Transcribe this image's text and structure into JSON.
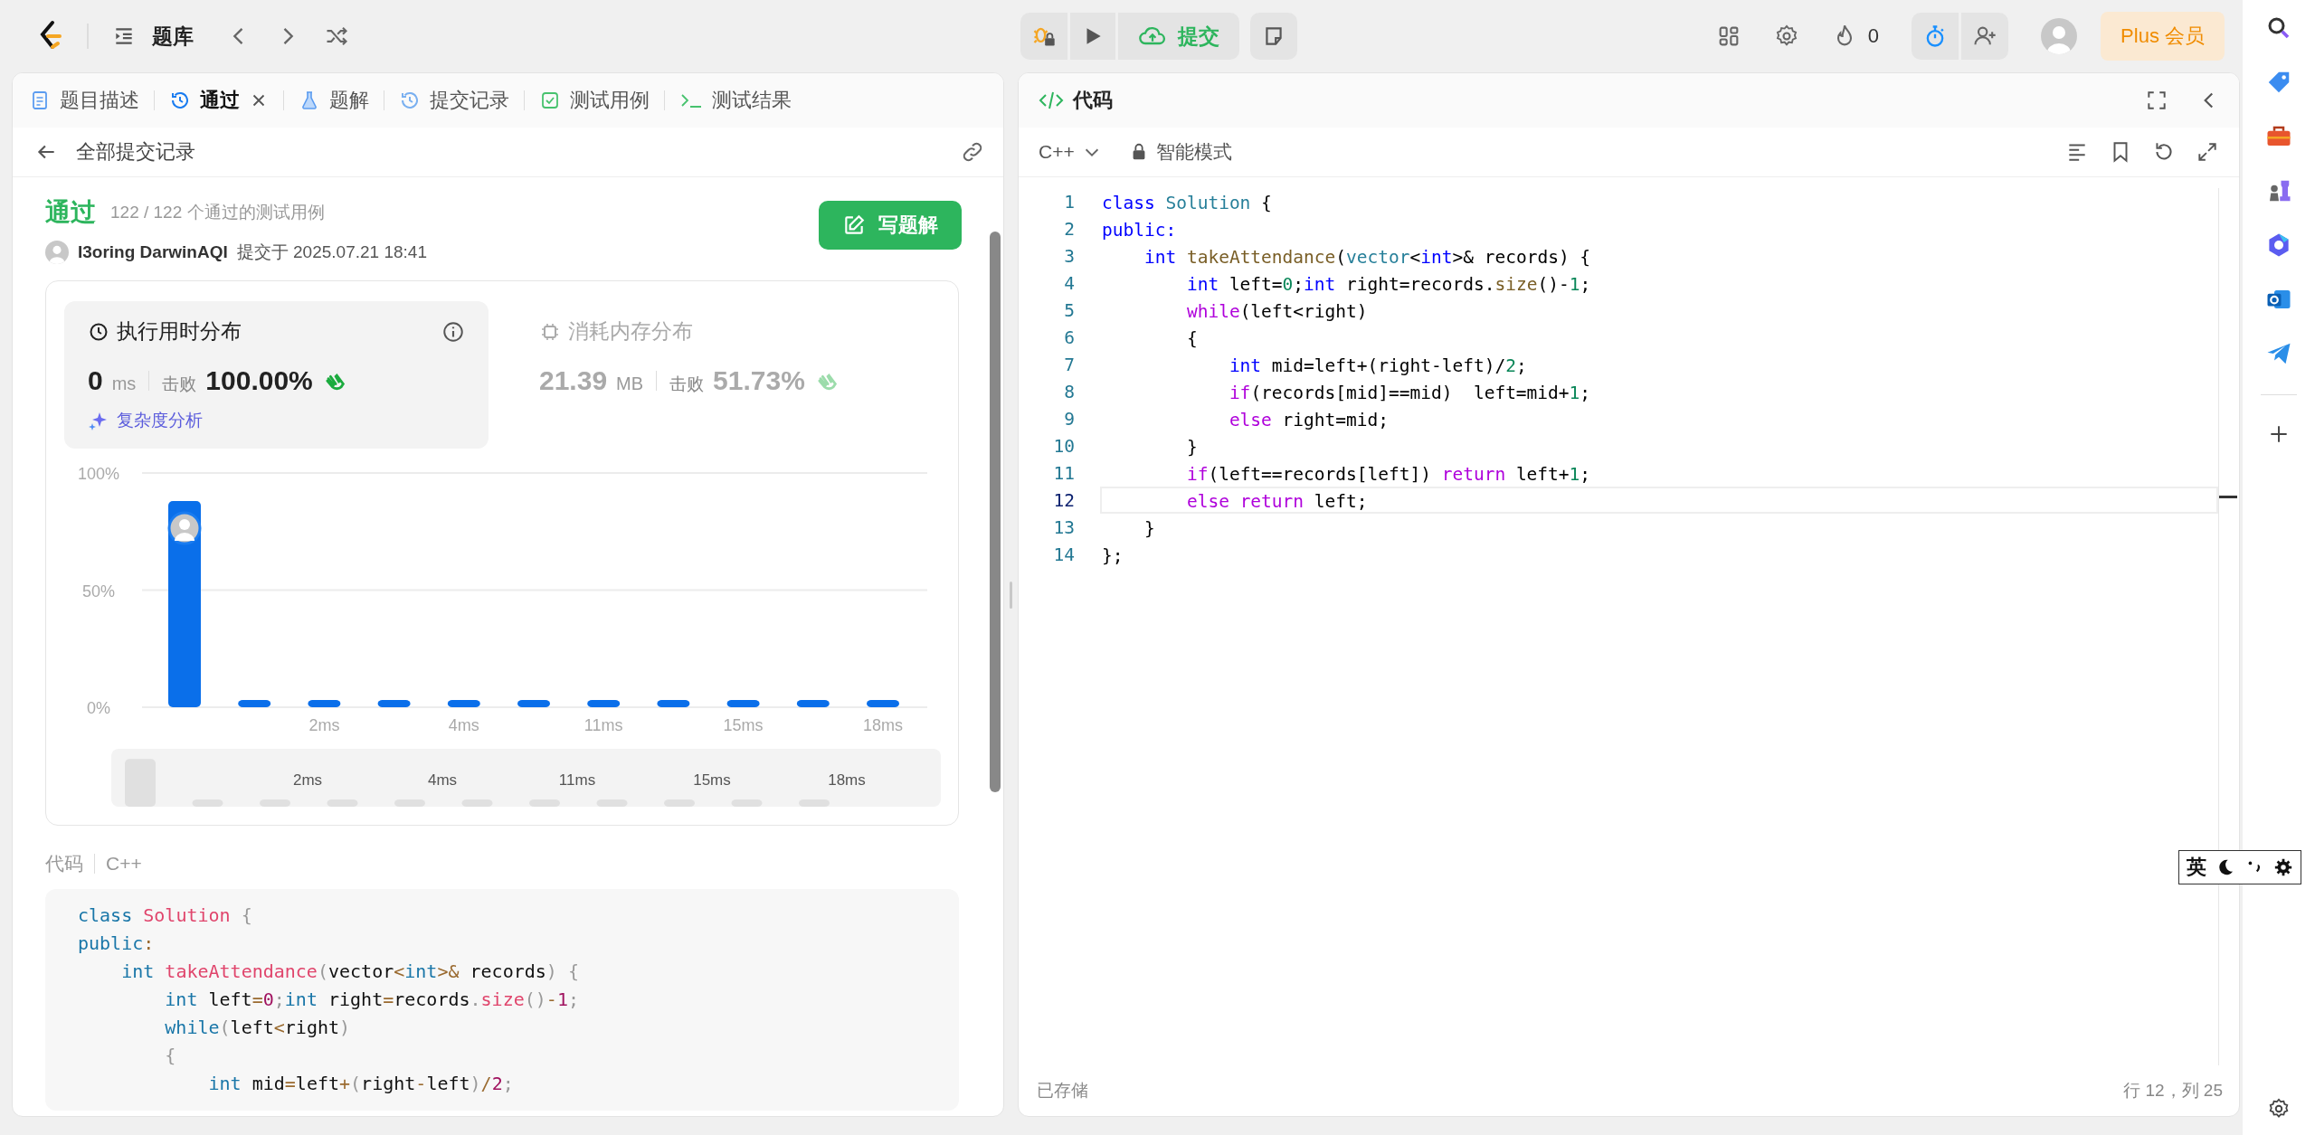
{
  "top_bar": {
    "nav_label": "题库",
    "submit_label": "提交",
    "streak": "0",
    "plus_label": "Plus 会员"
  },
  "left_tabs": [
    {
      "label": "题目描述",
      "kind": "doc",
      "selected": false,
      "closable": false
    },
    {
      "label": "通过",
      "kind": "history",
      "selected": true,
      "closable": true
    },
    {
      "label": "题解",
      "kind": "flask",
      "selected": false,
      "closable": false
    },
    {
      "label": "提交记录",
      "kind": "history",
      "selected": false,
      "closable": false
    },
    {
      "label": "测试用例",
      "kind": "check",
      "selected": false,
      "closable": false
    },
    {
      "label": "测试结果",
      "kind": "terminal",
      "selected": false,
      "closable": false
    }
  ],
  "back_label": "全部提交记录",
  "submission": {
    "status": "通过",
    "cases": "122 / 122 个通过的测试用例",
    "user": "I3oring DarwinAQI",
    "submitted": "提交于 2025.07.21 18:41",
    "write_button": "写题解"
  },
  "stats": [
    {
      "kind": "time",
      "title": "执行用时分布",
      "value": "0",
      "unit": "ms",
      "beats_label": "击败",
      "beats": "100.00%",
      "selected": true
    },
    {
      "kind": "memory",
      "title": "消耗内存分布",
      "value": "21.39",
      "unit": "MB",
      "beats_label": "击败",
      "beats": "51.73%",
      "selected": false
    }
  ],
  "complexity_link": "复杂度分析",
  "chart_data": {
    "type": "bar",
    "categories": [
      null,
      null,
      "2ms",
      null,
      "4ms",
      null,
      "11ms",
      null,
      "15ms",
      null,
      "18ms"
    ],
    "values": [
      88,
      3,
      3,
      3,
      3,
      3,
      3,
      3,
      3,
      3,
      3
    ],
    "ylim": [
      0,
      100
    ],
    "yticks": [
      {
        "value": 0,
        "label": "0%"
      },
      {
        "value": 50,
        "label": "50%"
      },
      {
        "value": 100,
        "label": "100%"
      }
    ]
  },
  "overview": {
    "labels": [
      "2ms",
      "4ms",
      "11ms",
      "15ms",
      "18ms"
    ]
  },
  "code_section": {
    "label": "代码",
    "language": "C++",
    "lines": [
      [
        {
          "t": "class",
          "kind": "kw"
        },
        {
          "t": " Solution",
          "kind": "fn"
        },
        {
          "t": " {",
          "kind": "pu"
        }
      ],
      [
        {
          "t": "public",
          "kind": "kw"
        },
        {
          "t": ":",
          "kind": "op"
        }
      ],
      [
        {
          "t": "    int",
          "kind": "kw"
        },
        {
          "t": " takeAttendance",
          "kind": "fn"
        },
        {
          "t": "(",
          "kind": "pu"
        },
        {
          "t": "vector"
        },
        {
          "t": "<",
          "kind": "op"
        },
        {
          "t": "int",
          "kind": "kw"
        },
        {
          "t": ">&",
          "kind": "op"
        },
        {
          "t": " records"
        },
        {
          "t": ") {",
          "kind": "pu"
        }
      ],
      [
        {
          "t": "        int",
          "kind": "kw"
        },
        {
          "t": " left"
        },
        {
          "t": "=",
          "kind": "op"
        },
        {
          "t": "0",
          "kind": "num"
        },
        {
          "t": ";",
          "kind": "pu"
        },
        {
          "t": "int",
          "kind": "kw"
        },
        {
          "t": " right"
        },
        {
          "t": "=",
          "kind": "op"
        },
        {
          "t": "records"
        },
        {
          "t": ".",
          "kind": "pu"
        },
        {
          "t": "size",
          "kind": "fn"
        },
        {
          "t": "()",
          "kind": "pu"
        },
        {
          "t": "-",
          "kind": "op"
        },
        {
          "t": "1",
          "kind": "num"
        },
        {
          "t": ";",
          "kind": "pu"
        }
      ],
      [
        {
          "t": "        while",
          "kind": "kw"
        },
        {
          "t": "(",
          "kind": "pu"
        },
        {
          "t": "left"
        },
        {
          "t": "<",
          "kind": "op"
        },
        {
          "t": "right"
        },
        {
          "t": ")",
          "kind": "pu"
        }
      ],
      [
        {
          "t": "        {",
          "kind": "pu"
        }
      ],
      [
        {
          "t": "            int",
          "kind": "kw"
        },
        {
          "t": " mid"
        },
        {
          "t": "=",
          "kind": "op"
        },
        {
          "t": "left"
        },
        {
          "t": "+",
          "kind": "op"
        },
        {
          "t": "(",
          "kind": "pu"
        },
        {
          "t": "right"
        },
        {
          "t": "-",
          "kind": "op"
        },
        {
          "t": "left"
        },
        {
          "t": ")",
          "kind": "pu"
        },
        {
          "t": "/",
          "kind": "op"
        },
        {
          "t": "2",
          "kind": "num"
        },
        {
          "t": ";",
          "kind": "pu"
        }
      ]
    ]
  },
  "editor": {
    "title": "代码",
    "language": "C++",
    "mode": "智能模式",
    "status": "已存储",
    "cursor": "行 12，列 25",
    "lines": [
      {
        "number": "1",
        "selected": false,
        "tokens": [
          {
            "t": "class",
            "kind": "kw"
          },
          {
            "t": " Solution",
            "kind": "type"
          },
          {
            "t": " {"
          }
        ]
      },
      {
        "number": "2",
        "selected": false,
        "tokens": [
          {
            "t": "public:",
            "kind": "kw"
          }
        ]
      },
      {
        "number": "3",
        "selected": false,
        "tokens": [
          {
            "t": "    int",
            "kind": "kw"
          },
          {
            "t": " takeAttendance",
            "kind": "fn"
          },
          {
            "t": "("
          },
          {
            "t": "vector",
            "kind": "type"
          },
          {
            "t": "<"
          },
          {
            "t": "int",
            "kind": "kw"
          },
          {
            "t": ">& records) {"
          }
        ]
      },
      {
        "number": "4",
        "selected": false,
        "tokens": [
          {
            "t": "        int",
            "kind": "kw"
          },
          {
            "t": " left="
          },
          {
            "t": "0",
            "kind": "num"
          },
          {
            "t": ";"
          },
          {
            "t": "int",
            "kind": "kw"
          },
          {
            "t": " right=records."
          },
          {
            "t": "size",
            "kind": "fn"
          },
          {
            "t": "()-"
          },
          {
            "t": "1",
            "kind": "num"
          },
          {
            "t": ";"
          }
        ]
      },
      {
        "number": "5",
        "selected": false,
        "tokens": [
          {
            "t": "        while",
            "kind": "ctrl"
          },
          {
            "t": "(left<right)"
          }
        ]
      },
      {
        "number": "6",
        "selected": false,
        "tokens": [
          {
            "t": "        {"
          }
        ]
      },
      {
        "number": "7",
        "selected": false,
        "tokens": [
          {
            "t": "            int",
            "kind": "kw"
          },
          {
            "t": " mid=left+(right-left)/"
          },
          {
            "t": "2",
            "kind": "num"
          },
          {
            "t": ";"
          }
        ]
      },
      {
        "number": "8",
        "selected": false,
        "tokens": [
          {
            "t": "            if",
            "kind": "ctrl"
          },
          {
            "t": "(records[mid]==mid)  left=mid+"
          },
          {
            "t": "1",
            "kind": "num"
          },
          {
            "t": ";"
          }
        ]
      },
      {
        "number": "9",
        "selected": false,
        "tokens": [
          {
            "t": "            else",
            "kind": "ctrl"
          },
          {
            "t": " right=mid;"
          }
        ]
      },
      {
        "number": "10",
        "selected": false,
        "tokens": [
          {
            "t": "        }"
          }
        ]
      },
      {
        "number": "11",
        "selected": false,
        "tokens": [
          {
            "t": "        if",
            "kind": "ctrl"
          },
          {
            "t": "(left==records[left]) "
          },
          {
            "t": "return",
            "kind": "ctrl"
          },
          {
            "t": " left+"
          },
          {
            "t": "1",
            "kind": "num"
          },
          {
            "t": ";"
          }
        ]
      },
      {
        "number": "12",
        "selected": true,
        "tokens": [
          {
            "t": "        else",
            "kind": "ctrl"
          },
          {
            "t": " return",
            "kind": "ctrl"
          },
          {
            "t": " left;"
          }
        ]
      },
      {
        "number": "13",
        "selected": false,
        "tokens": [
          {
            "t": "    }"
          }
        ]
      },
      {
        "number": "14",
        "selected": false,
        "tokens": [
          {
            "t": "};"
          }
        ]
      }
    ]
  },
  "ime": {
    "label": "英"
  }
}
